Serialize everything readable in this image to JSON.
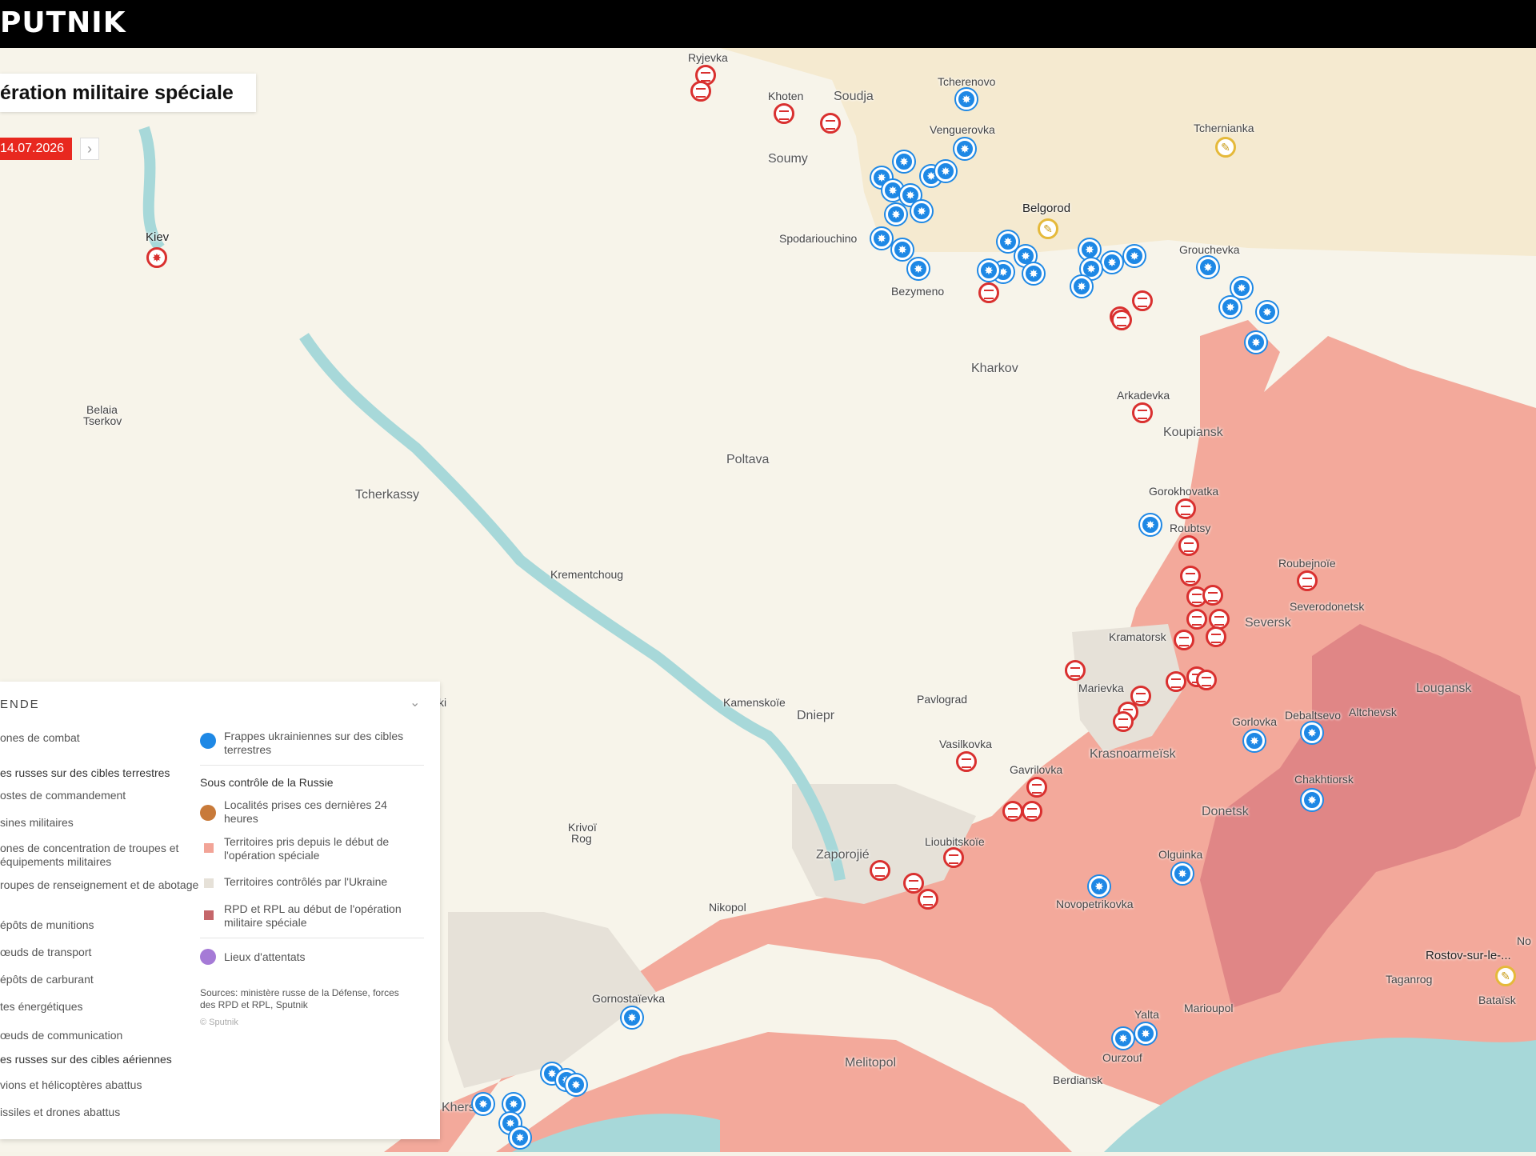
{
  "brand": {
    "logo": "PUTNIK"
  },
  "header": {
    "title": "ération militaire spéciale",
    "date": "14.07.2026",
    "next": "›"
  },
  "colors": {
    "russian_control": "#f2a497",
    "dpr_lpr": "#de8284",
    "ukraine_control": "#e6e1d8",
    "water": "#a7d8d9",
    "strike_blue": "#1e88e5",
    "strike_red": "#d9302f",
    "attack_yellow": "#e5b93a"
  },
  "places": {
    "ryjevka": "Ryjevka",
    "khoten": "Khoten",
    "soudja": "Soudja",
    "tcherenovo": "Tcherenovo",
    "tchernianka": "Tchernianka",
    "venguerovka": "Venguerovka",
    "soumy": "Soumy",
    "belgorod": "Belgorod",
    "kiev": "Kiev",
    "spodariouchino": "Spodariouchino",
    "grouchevka": "Grouchevka",
    "bezymeno": "Bezymeno",
    "kharkov": "Kharkov",
    "belaia": "Belaia",
    "tserkov": "Tserkov",
    "arkadevka": "Arkadevka",
    "koupiansk": "Koupiansk",
    "poltava": "Poltava",
    "tcherkassy": "Tcherkassy",
    "gorokhovatka": "Gorokhovatka",
    "roubtsy": "Roubtsy",
    "kremetchoug": "Krementchoug",
    "roubejnoie": "Roubejnoïe",
    "severodonetsk": "Severodonetsk",
    "seversk": "Seversk",
    "kramatorsk": "Kramatorsk",
    "marievka": "Marievka",
    "lougansk": "Lougansk",
    "alchevsk": "Altchevsk",
    "kamenskoie": "Kamenskoïe",
    "dniepr": "Dniepr",
    "pavlograd": "Pavlograd",
    "gorlovka": "Gorlovka",
    "debaltsevo": "Debaltsevo",
    "vasilkovka": "Vasilkovka",
    "krasnoarmeisk": "Krasnoarmeïsk",
    "gavrilovka": "Gavrilovka",
    "chakhtiorsk": "Chakhtiorsk",
    "donetsk": "Donetsk",
    "krivoi": "Krivoï",
    "rog": "Rog",
    "zaporojie": "Zaporojié",
    "lioubitskoie": "Lioubitskoïe",
    "olguinka": "Olguinka",
    "novopetrikovka": "Novopetrikovka",
    "nikopol": "Nikopol",
    "rostov": "Rostov-sur-le-...",
    "taganrog": "Taganrog",
    "bataisk": "Bataïsk",
    "gornostaievka": "Gornostaïevka",
    "yalta": "Yalta",
    "marioupol": "Marioupol",
    "ourzouf": "Ourzouf",
    "melitopol": "Melitopol",
    "berdiansk": "Berdiansk",
    "kherson": "Kherson",
    "ki": "ki",
    "no": "No"
  },
  "legend": {
    "heading": "ENDE",
    "toggle": "⌄",
    "combat": "ones de combat",
    "russian_ground": "es russes sur des cibles terrestres",
    "command_posts": "ostes de commandement",
    "factories": "sines militaires",
    "troop_concentration": "ones de concentration de troupes et équipements militaires",
    "sabotage": "roupes de renseignement et de abotage",
    "ammo": "épôts de munitions",
    "transport": "œuds de transport",
    "fuel": "épôts de carburant",
    "energy": "tes énergétiques",
    "communication": "œuds de communication",
    "russian_air": "es russes sur des cibles aériennes",
    "aircraft": "vions et hélicoptères abattus",
    "missiles": "issiles et drones abattus",
    "ukr_strikes": "Frappes ukrainiennes sur des cibles terrestres",
    "russia_control": "Sous contrôle de la Russie",
    "localities": "Localités prises ces dernières 24 heures",
    "territories_taken": "Territoires pris depuis le début de l'opération spéciale",
    "ukraine_territories": "Territoires contrôlés par l'Ukraine",
    "dpr_lpr": "RPD et RPL au début de l'opération militaire spéciale",
    "attacks": "Lieux d'attentats",
    "sources": "Sources: ministère russe de la Défense, forces des RPD et RPL, Sputnik",
    "copyright": "© Sputnik"
  }
}
